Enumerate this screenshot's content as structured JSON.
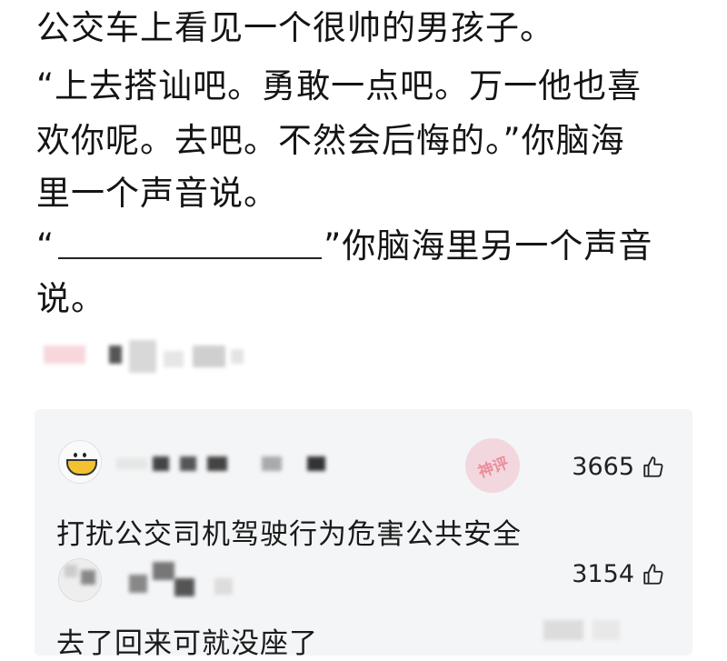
{
  "post": {
    "lines": [
      "公交车上看见一个很帅的男孩子。",
      "“上去搭讪吧。勇敢一点吧。万一他也喜",
      "欢你呢。去吧。不然会后悔的。”你脑海",
      "里一个声音说。",
      "",
      "说。"
    ],
    "blank_open_quote": "“",
    "blank_close_quote": "”你脑海里另一个声音"
  },
  "comments": [
    {
      "likes": "3665",
      "text": "打扰公交司机驾驶行为危害公共安全"
    },
    {
      "likes": "3154",
      "text": "去了回来可就没座了"
    }
  ],
  "watermark_text": "神评",
  "colors": {
    "comment_bg": "#f4f5f7",
    "text": "#141414",
    "avatar_yellow": "#f2c230"
  },
  "icons": {
    "like": "thumbs-up-icon"
  }
}
